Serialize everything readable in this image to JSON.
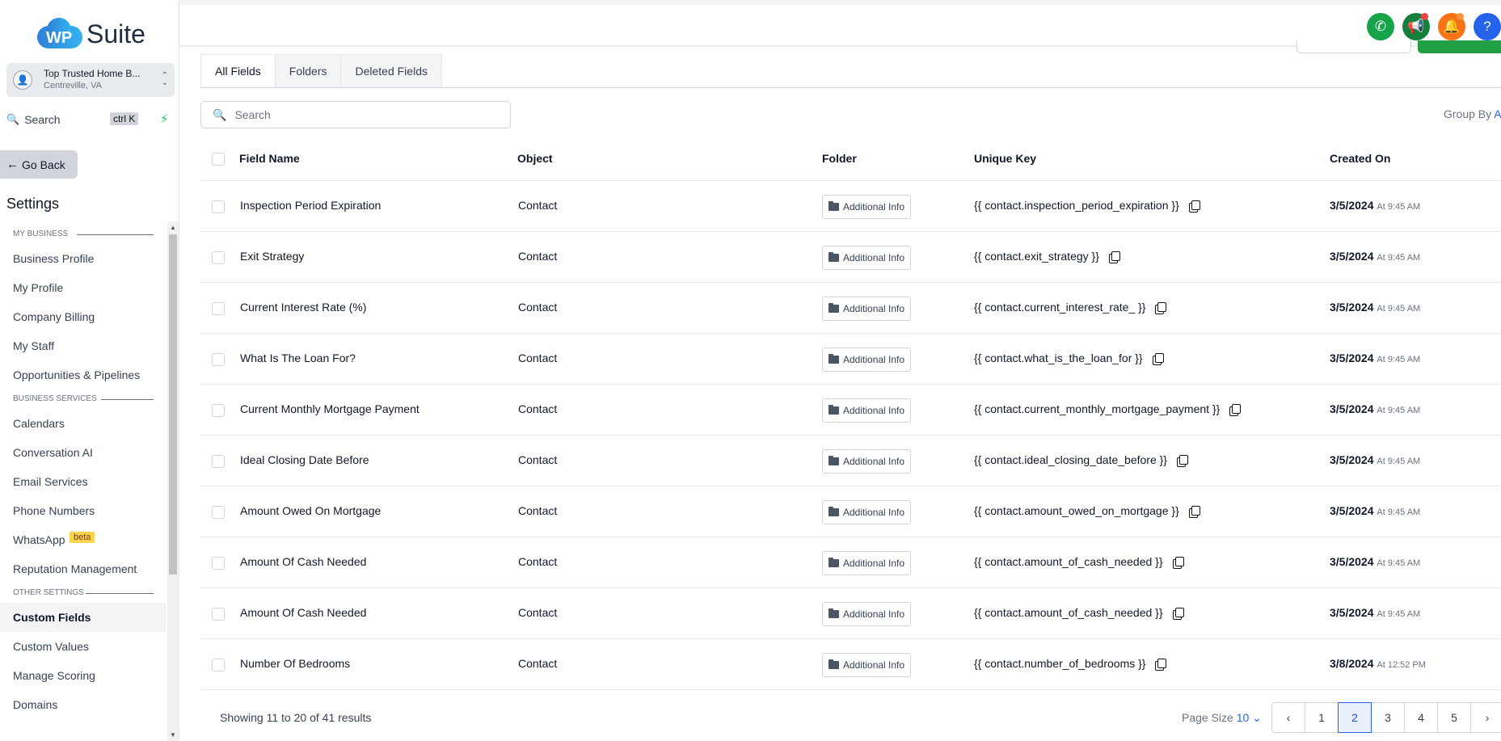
{
  "logo": {
    "badge": "WP",
    "text": "Suite"
  },
  "account": {
    "name": "Top Trusted Home B...",
    "location": "Centreville, VA"
  },
  "sidebar_search": {
    "label": "Search",
    "shortcut": "ctrl K"
  },
  "go_back": "Go Back",
  "settings_title": "Settings",
  "menu": {
    "my_business": {
      "heading": "MY BUSINESS",
      "items": [
        "Business Profile",
        "My Profile",
        "Company Billing",
        "My Staff",
        "Opportunities & Pipelines"
      ]
    },
    "business_services": {
      "heading": "BUSINESS SERVICES",
      "items": [
        "Calendars",
        "Conversation AI",
        "Email Services",
        "Phone Numbers",
        "WhatsApp",
        "Reputation Management"
      ],
      "whatsapp_badge": "beta"
    },
    "other_settings": {
      "heading": "OTHER SETTINGS",
      "items": [
        "Custom Fields",
        "Custom Values",
        "Manage Scoring",
        "Domains"
      ],
      "active": "Custom Fields"
    }
  },
  "top_icons": [
    {
      "name": "phone-icon",
      "color": "#16a34a",
      "glyph": "✆"
    },
    {
      "name": "megaphone-icon",
      "color": "#15803d",
      "glyph": "📢"
    },
    {
      "name": "bell-icon",
      "color": "#f97316",
      "glyph": "🔔"
    },
    {
      "name": "help-icon",
      "color": "#2563eb",
      "glyph": "?"
    }
  ],
  "tabs": [
    "All Fields",
    "Folders",
    "Deleted Fields"
  ],
  "search": {
    "placeholder": "Search"
  },
  "group_by": {
    "label": "Group By",
    "value": "A"
  },
  "table": {
    "columns": [
      "Field Name",
      "Object",
      "Folder",
      "Unique Key",
      "Created On"
    ],
    "rows": [
      {
        "name": "Inspection Period Expiration",
        "object": "Contact",
        "folder": "Additional Info",
        "key": "{{ contact.inspection_period_expiration }}",
        "date": "3/5/2024",
        "time": "At 9:45 AM"
      },
      {
        "name": "Exit Strategy",
        "object": "Contact",
        "folder": "Additional Info",
        "key": "{{ contact.exit_strategy }}",
        "date": "3/5/2024",
        "time": "At 9:45 AM"
      },
      {
        "name": "Current Interest Rate (%)",
        "object": "Contact",
        "folder": "Additional Info",
        "key": "{{ contact.current_interest_rate_ }}",
        "date": "3/5/2024",
        "time": "At 9:45 AM"
      },
      {
        "name": "What Is The Loan For?",
        "object": "Contact",
        "folder": "Additional Info",
        "key": "{{ contact.what_is_the_loan_for }}",
        "date": "3/5/2024",
        "time": "At 9:45 AM"
      },
      {
        "name": "Current Monthly Mortgage Payment",
        "object": "Contact",
        "folder": "Additional Info",
        "key": "{{ contact.current_monthly_mortgage_payment }}",
        "date": "3/5/2024",
        "time": "At 9:45 AM"
      },
      {
        "name": "Ideal Closing Date Before",
        "object": "Contact",
        "folder": "Additional Info",
        "key": "{{ contact.ideal_closing_date_before }}",
        "date": "3/5/2024",
        "time": "At 9:45 AM"
      },
      {
        "name": "Amount Owed On Mortgage",
        "object": "Contact",
        "folder": "Additional Info",
        "key": "{{ contact.amount_owed_on_mortgage }}",
        "date": "3/5/2024",
        "time": "At 9:45 AM"
      },
      {
        "name": "Amount Of Cash Needed",
        "object": "Contact",
        "folder": "Additional Info",
        "key": "{{ contact.amount_of_cash_needed }}",
        "date": "3/5/2024",
        "time": "At 9:45 AM"
      },
      {
        "name": "Amount Of Cash Needed",
        "object": "Contact",
        "folder": "Additional Info",
        "key": "{{ contact.amount_of_cash_needed }}",
        "date": "3/5/2024",
        "time": "At 9:45 AM"
      },
      {
        "name": "Number Of Bedrooms",
        "object": "Contact",
        "folder": "Additional Info",
        "key": "{{ contact.number_of_bedrooms }}",
        "date": "3/8/2024",
        "time": "At 12:52 PM"
      }
    ]
  },
  "footer": {
    "showing_prefix": "Showing",
    "from": "11",
    "to_word": "to",
    "to": "20",
    "of_word": "of",
    "total": "41",
    "results_word": "results",
    "page_size_label": "Page Size",
    "page_size": "10",
    "pages": [
      "1",
      "2",
      "3",
      "4",
      "5"
    ],
    "current_page": "2"
  }
}
